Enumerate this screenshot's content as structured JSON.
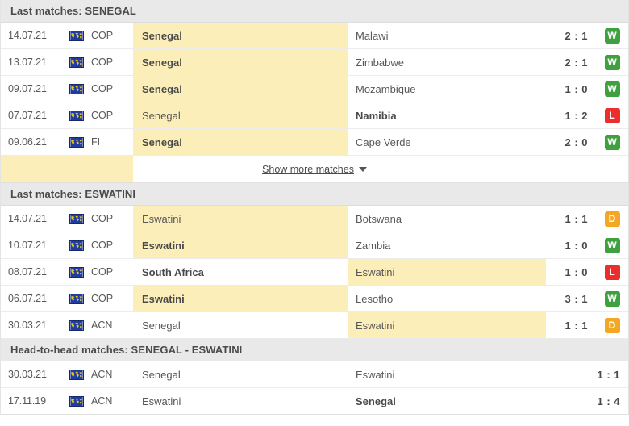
{
  "sections": [
    {
      "id": "last-matches-senegal",
      "title": "Last matches: SENEGAL",
      "has_show_more": true,
      "show_more_label": "Show more matches",
      "rows": [
        {
          "date": "14.07.21",
          "flag": "world-flag-icon",
          "comp": "COP",
          "home": "Senegal",
          "away": "Malawi",
          "score": "2 : 1",
          "result": "W",
          "home_hl": true,
          "away_hl": false,
          "home_win": true,
          "away_win": false
        },
        {
          "date": "13.07.21",
          "flag": "world-flag-icon",
          "comp": "COP",
          "home": "Senegal",
          "away": "Zimbabwe",
          "score": "2 : 1",
          "result": "W",
          "home_hl": true,
          "away_hl": false,
          "home_win": true,
          "away_win": false
        },
        {
          "date": "09.07.21",
          "flag": "world-flag-icon",
          "comp": "COP",
          "home": "Senegal",
          "away": "Mozambique",
          "score": "1 : 0",
          "result": "W",
          "home_hl": true,
          "away_hl": false,
          "home_win": true,
          "away_win": false
        },
        {
          "date": "07.07.21",
          "flag": "world-flag-icon",
          "comp": "COP",
          "home": "Senegal",
          "away": "Namibia",
          "score": "1 : 2",
          "result": "L",
          "home_hl": true,
          "away_hl": false,
          "home_win": false,
          "away_win": true
        },
        {
          "date": "09.06.21",
          "flag": "world-flag-icon",
          "comp": "FI",
          "home": "Senegal",
          "away": "Cape Verde",
          "score": "2 : 0",
          "result": "W",
          "home_hl": true,
          "away_hl": false,
          "home_win": true,
          "away_win": false
        }
      ]
    },
    {
      "id": "last-matches-eswatini",
      "title": "Last matches: ESWATINI",
      "has_show_more": false,
      "show_more_label": "",
      "rows": [
        {
          "date": "14.07.21",
          "flag": "world-flag-icon",
          "comp": "COP",
          "home": "Eswatini",
          "away": "Botswana",
          "score": "1 : 1",
          "result": "D",
          "home_hl": true,
          "away_hl": false,
          "home_win": false,
          "away_win": false
        },
        {
          "date": "10.07.21",
          "flag": "world-flag-icon",
          "comp": "COP",
          "home": "Eswatini",
          "away": "Zambia",
          "score": "1 : 0",
          "result": "W",
          "home_hl": true,
          "away_hl": false,
          "home_win": true,
          "away_win": false
        },
        {
          "date": "08.07.21",
          "flag": "world-flag-icon",
          "comp": "COP",
          "home": "South Africa",
          "away": "Eswatini",
          "score": "1 : 0",
          "result": "L",
          "home_hl": false,
          "away_hl": true,
          "home_win": true,
          "away_win": false
        },
        {
          "date": "06.07.21",
          "flag": "world-flag-icon",
          "comp": "COP",
          "home": "Eswatini",
          "away": "Lesotho",
          "score": "3 : 1",
          "result": "W",
          "home_hl": true,
          "away_hl": false,
          "home_win": true,
          "away_win": false
        },
        {
          "date": "30.03.21",
          "flag": "world-flag-icon",
          "comp": "ACN",
          "home": "Senegal",
          "away": "Eswatini",
          "score": "1 : 1",
          "result": "D",
          "home_hl": false,
          "away_hl": true,
          "home_win": false,
          "away_win": false
        }
      ]
    },
    {
      "id": "head-to-head",
      "title": "Head-to-head matches: SENEGAL - ESWATINI",
      "has_show_more": false,
      "show_more_label": "",
      "rows": [
        {
          "date": "30.03.21",
          "flag": "world-flag-icon",
          "comp": "ACN",
          "home": "Senegal",
          "away": "Eswatini",
          "score": "1 : 1",
          "result": "",
          "home_hl": false,
          "away_hl": false,
          "home_win": false,
          "away_win": false
        },
        {
          "date": "17.11.19",
          "flag": "world-flag-icon",
          "comp": "ACN",
          "home": "Eswatini",
          "away": "Senegal",
          "score": "1 : 4",
          "result": "",
          "home_hl": false,
          "away_hl": false,
          "home_win": false,
          "away_win": true
        }
      ]
    }
  ],
  "colors": {
    "highlight": "#fceeb9",
    "header_bg": "#e9e9e9",
    "win_badge": "#3ea03e",
    "loss_badge": "#eb2d2d",
    "draw_badge": "#f5a623",
    "flag_bg": "#1f3d9e",
    "flag_land": "#f2c21a"
  }
}
